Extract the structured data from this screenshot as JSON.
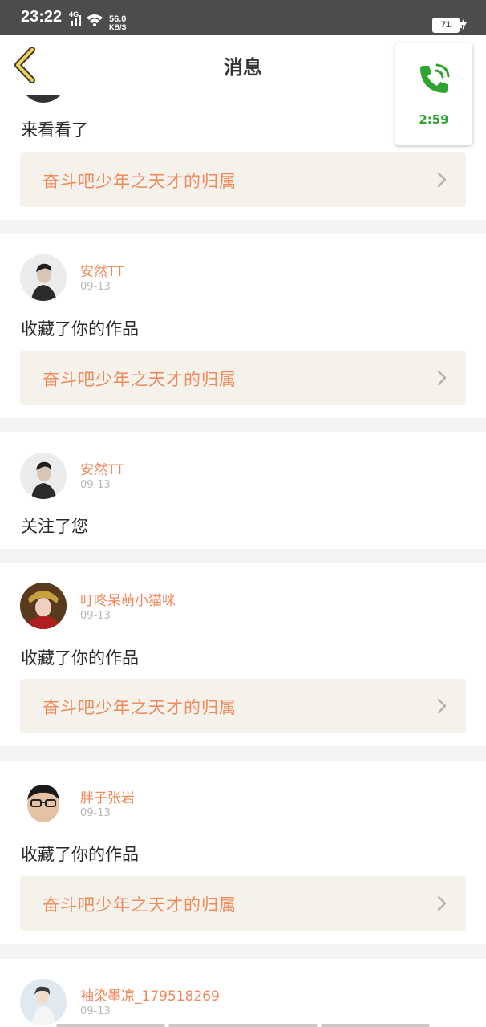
{
  "status_bar": {
    "time": "23:22",
    "network": "4G",
    "net_speed_value": "56.0",
    "net_speed_unit": "KB/S",
    "battery": "71"
  },
  "nav": {
    "title": "消息"
  },
  "call": {
    "timer": "2:59",
    "color": "#2fa52f"
  },
  "messages": [
    {
      "action": "来看看了",
      "work_title": "奋斗吧少年之天才的归属"
    },
    {
      "username": "安然TT",
      "date": "09-13",
      "action": "收藏了你的作品",
      "work_title": "奋斗吧少年之天才的归属"
    },
    {
      "username": "安然TT",
      "date": "09-13",
      "action": "关注了您"
    },
    {
      "username": "叮咚呆萌小猫咪",
      "date": "09-13",
      "action": "收藏了你的作品",
      "work_title": "奋斗吧少年之天才的归属"
    },
    {
      "username": "胖子张岩",
      "date": "09-13",
      "action": "收藏了你的作品",
      "work_title": "奋斗吧少年之天才的归属"
    },
    {
      "username": "袖染墨凉_179518269",
      "date": "09-13"
    }
  ],
  "colors": {
    "accent": "#f0875a",
    "link_bg": "#f4f2ea",
    "status_bar": "#4c4c4c"
  }
}
